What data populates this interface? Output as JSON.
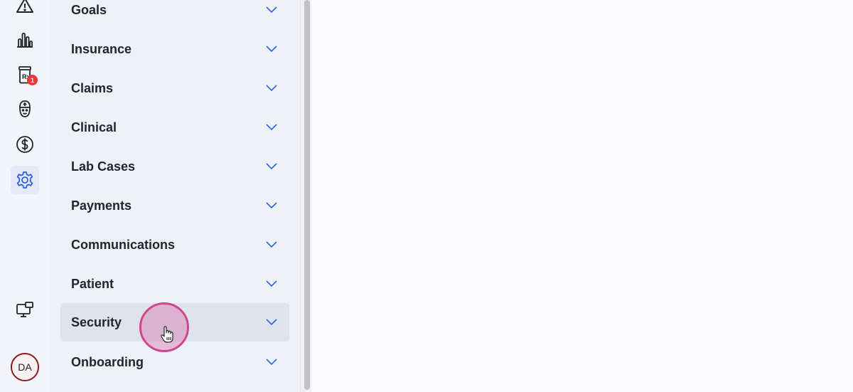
{
  "rail": {
    "items": [
      {
        "name": "alert-triangle-icon",
        "active": false
      },
      {
        "name": "bar-chart-icon",
        "active": false
      },
      {
        "name": "prescription-icon",
        "active": false,
        "badge": "1"
      },
      {
        "name": "nurse-icon",
        "active": false
      },
      {
        "name": "dollar-icon",
        "active": false
      },
      {
        "name": "gear-icon",
        "active": true
      },
      {
        "name": "monitor-icon",
        "active": false
      }
    ],
    "avatar": "DA"
  },
  "settings_menu": {
    "items": [
      {
        "label": "Goals"
      },
      {
        "label": "Insurance"
      },
      {
        "label": "Claims"
      },
      {
        "label": "Clinical"
      },
      {
        "label": "Lab Cases"
      },
      {
        "label": "Payments"
      },
      {
        "label": "Communications"
      },
      {
        "label": "Patient"
      },
      {
        "label": "Security",
        "hovered": true
      },
      {
        "label": "Onboarding"
      }
    ]
  },
  "colors": {
    "accent": "#2f5fe0",
    "badge": "#e5383b",
    "cursor_ring": "#d2468f"
  }
}
